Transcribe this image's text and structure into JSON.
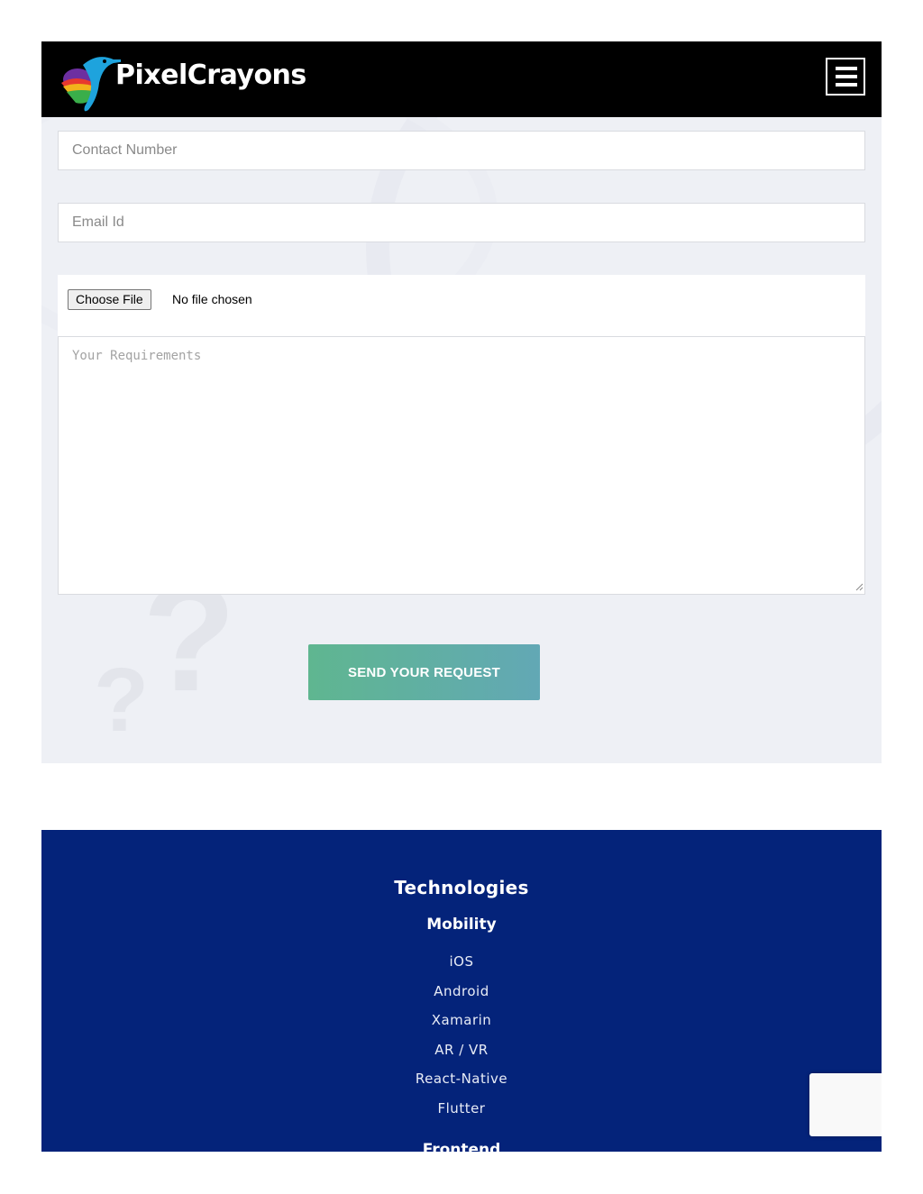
{
  "header": {
    "brand": "PixelCrayons",
    "menu_icon": "hamburger-menu-icon"
  },
  "form": {
    "contact_placeholder": "Contact Number",
    "email_placeholder": "Email Id",
    "file_button_label": "Choose File",
    "file_status": "No file chosen",
    "requirements_placeholder": "Your Requirements",
    "submit_label": "SEND YOUR REQUEST"
  },
  "footer": {
    "title": "Technologies",
    "category": "Mobility",
    "items": [
      "iOS",
      "Android",
      "Xamarin",
      "AR / VR",
      "React-Native",
      "Flutter"
    ],
    "next_category": "Frontend"
  },
  "colors": {
    "header_bg": "#000000",
    "form_bg": "#eef0f5",
    "button_gradient_start": "#5fb690",
    "button_gradient_end": "#62a8b5",
    "footer_bg": "#04237a"
  }
}
